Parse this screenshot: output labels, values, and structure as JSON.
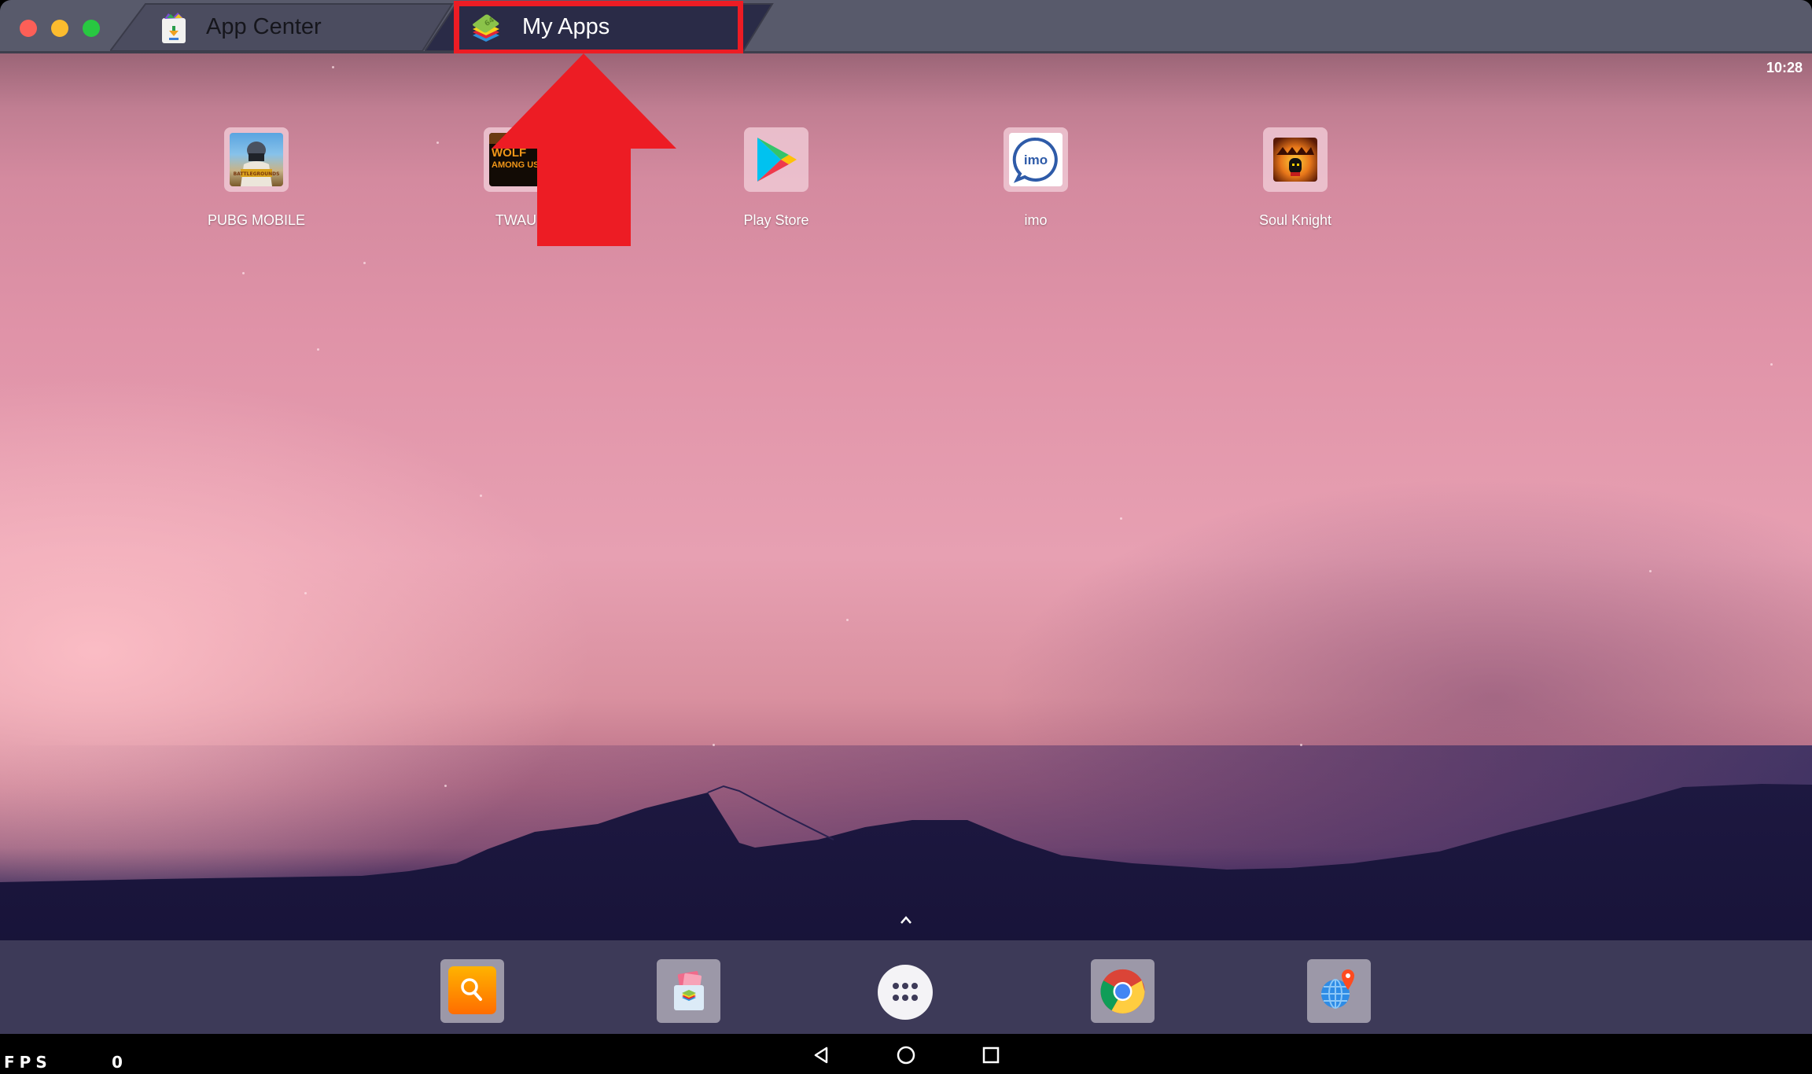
{
  "window": {
    "traffic_lights": [
      "close",
      "minimize",
      "zoom"
    ],
    "tabs": [
      {
        "label": "App Center",
        "icon": "app-center-icon",
        "active": false
      },
      {
        "label": "My Apps",
        "icon": "bluestacks-icon",
        "active": true
      }
    ]
  },
  "annotation": {
    "highlight_target": "My Apps",
    "highlight_color": "#ed1c24",
    "arrow_direction": "up"
  },
  "status_bar": {
    "time": "10:28"
  },
  "home_apps": [
    {
      "label": "PUBG MOBILE",
      "icon": "pubg-mobile-icon"
    },
    {
      "label": "TWAU",
      "icon": "wolf-among-us-icon"
    },
    {
      "label": "Play Store",
      "icon": "play-store-icon"
    },
    {
      "label": "imo",
      "icon": "imo-icon"
    },
    {
      "label": "Soul Knight",
      "icon": "soul-knight-icon"
    }
  ],
  "imo_text": "imo",
  "dock": [
    {
      "name": "search",
      "icon": "search-icon"
    },
    {
      "name": "media-manager",
      "icon": "media-folder-icon"
    },
    {
      "name": "app-drawer",
      "icon": "app-drawer-icon"
    },
    {
      "name": "chrome",
      "icon": "chrome-icon"
    },
    {
      "name": "location",
      "icon": "globe-location-icon"
    }
  ],
  "navbar": {
    "fps_label": "FPS",
    "fps_value": "0",
    "buttons": [
      "back",
      "home",
      "recents"
    ]
  }
}
